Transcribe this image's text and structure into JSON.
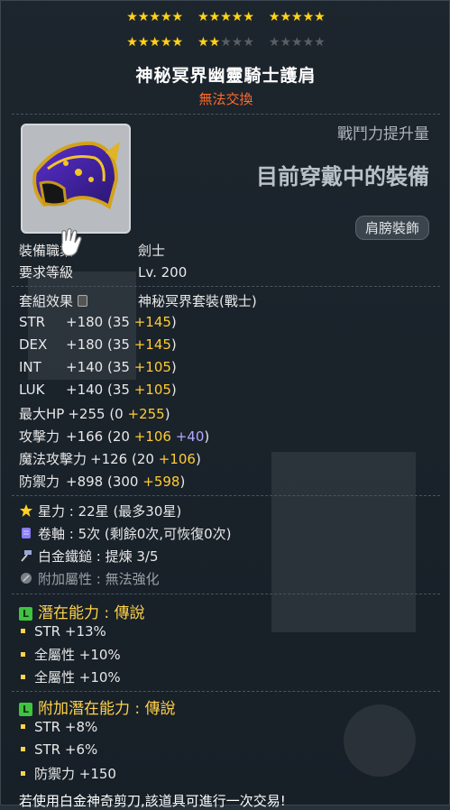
{
  "stars": {
    "rows": [
      [
        "on",
        "on",
        "on",
        "on",
        "on",
        "on",
        "on",
        "on",
        "on",
        "on",
        "on",
        "on",
        "on",
        "on",
        "on"
      ],
      [
        "on",
        "on",
        "on",
        "on",
        "on",
        "on",
        "on",
        "off",
        "off",
        "off",
        "off",
        "off",
        "off",
        "off",
        "off"
      ]
    ],
    "filled": 22,
    "max": 30,
    "star_color": "#ffd21e"
  },
  "item": {
    "name": "神秘冥界幽靈騎士護肩",
    "tradeable_text": "無法交換",
    "power_label": "戰鬥力提升量",
    "equipped_text": "目前穿戴中的裝備",
    "slot": "肩膀裝飾"
  },
  "requirements": {
    "job_label": "裝備職業",
    "job_value": "劍士",
    "level_label": "要求等級",
    "level_value": "Lv. 200"
  },
  "set": {
    "label": "套組效果",
    "name": "神秘冥界套裝(戰士)"
  },
  "stats": [
    {
      "name": "STR",
      "total": "+180",
      "base": "35",
      "bonus": "+145",
      "extra": ""
    },
    {
      "name": "DEX",
      "total": "+180",
      "base": "35",
      "bonus": "+145",
      "extra": ""
    },
    {
      "name": "INT",
      "total": "+140",
      "base": "35",
      "bonus": "+105",
      "extra": ""
    },
    {
      "name": "LUK",
      "total": "+140",
      "base": "35",
      "bonus": "+105",
      "extra": ""
    },
    {
      "name": "最大HP",
      "total": "+255",
      "base": "0",
      "bonus": "+255",
      "extra": ""
    },
    {
      "name": "攻擊力",
      "total": "+166",
      "base": "20",
      "bonus": "+106",
      "extra": "+40"
    },
    {
      "name": "魔法攻擊力",
      "total": "+126",
      "base": "20",
      "bonus": "+106",
      "extra": ""
    },
    {
      "name": "防禦力",
      "total": "+898",
      "base": "300",
      "bonus": "+598",
      "extra": ""
    }
  ],
  "enhance": {
    "starforce": "星力 : 22星 (最多30星)",
    "scroll": "卷軸 : 5次 (剩餘0次,可恢復0次)",
    "hammer": "白金鐵鎚 : 提煉 3/5",
    "addition": "附加屬性 : 無法強化"
  },
  "potential": {
    "title": "潛在能力 : 傳說",
    "lines": [
      "STR +13%",
      "全屬性 +10%",
      "全屬性 +10%"
    ]
  },
  "bonus_potential": {
    "title": "附加潛在能力 : 傳說",
    "lines": [
      "STR +8%",
      "STR +6%",
      "防禦力 +150"
    ]
  },
  "footer": "若使用白金神奇剪刀,該道具可進行一次交易!"
}
